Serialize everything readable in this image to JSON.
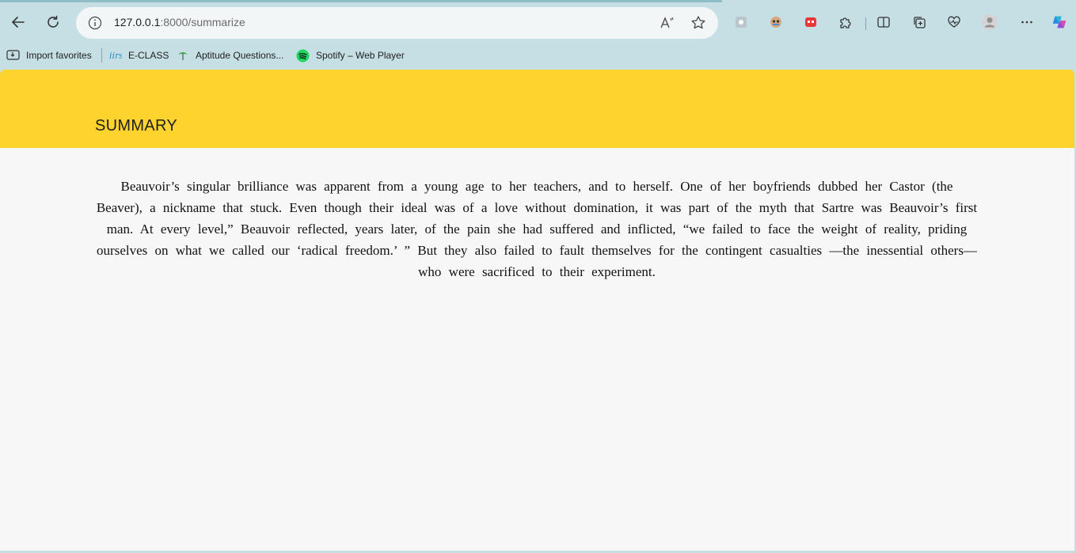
{
  "browser": {
    "url_host": "127.0.0.1",
    "url_path": ":8000/summarize",
    "back_icon": "back-arrow-icon",
    "refresh_icon": "refresh-icon",
    "info_icon": "site-info-icon",
    "read_aloud_icon": "read-aloud-icon",
    "favorite_icon": "favorite-star-icon",
    "extensions": [
      "extension-1-icon",
      "extension-2-icon",
      "extension-3-icon",
      "extensions-puzzle-icon",
      "split-screen-icon",
      "collections-icon",
      "health-icon",
      "profile-avatar-icon",
      "more-menu-icon",
      "copilot-icon"
    ]
  },
  "bookmarks": [
    {
      "label": "Import favorites",
      "icon": "import-favorites-icon"
    },
    {
      "label": "E-CLASS",
      "icon": "iirs-logo-icon"
    },
    {
      "label": "Aptitude Questions...",
      "icon": "aptitude-icon"
    },
    {
      "label": "Spotify – Web Player",
      "icon": "spotify-icon"
    }
  ],
  "page": {
    "header_title": "SUMMARY",
    "summary": "Beauvoir’s singular brilliance was apparent from a young age to her teachers, and to herself. One of her boyfriends dubbed her Castor (the Beaver), a nickname that stuck. Even though their ideal was of a love without domination, it was part of the myth that Sartre was Beauvoir’s first man. At every level,” Beauvoir reflected, years later, of the pain she had suffered and inflicted, “we failed to face the weight of reality, priding ourselves on what we called our ‘radical freedom.’ ” But they also failed to fault themselves for the contingent casualties —the inessential others—who were sacrificed to their experiment."
  },
  "colors": {
    "browser_frame": "#c5dfe4",
    "header_bg": "#fed32e",
    "page_bg": "#f7f7f7"
  }
}
